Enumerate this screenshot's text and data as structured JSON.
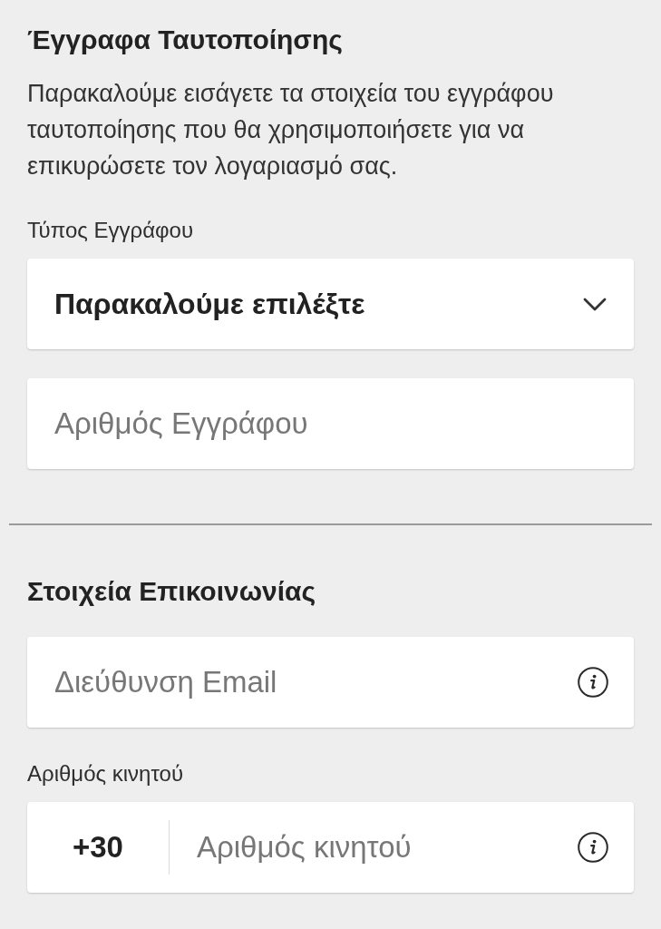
{
  "sections": [
    {
      "title": "Έγγραφα Ταυτοποίησης",
      "description": "Παρακαλούμε εισάγετε τα στοιχεία του εγγράφου ταυτοποίησης που θα χρησιμοποιήσετε για να επικυρώσετε τον λογαριασμό σας.",
      "fields": [
        {
          "kind": "select",
          "label": "Τύπος Εγγράφου",
          "value": "Παρακαλούμε επιλέξτε"
        },
        {
          "kind": "text",
          "placeholder": "Αριθμός Εγγράφου",
          "info": false
        }
      ]
    },
    {
      "title": "Στοιχεία Επικοινωνίας",
      "fields": [
        {
          "kind": "text",
          "placeholder": "Διεύθυνση Email",
          "info": true
        },
        {
          "kind": "phone",
          "label": "Αριθμός κινητού",
          "prefix": "+30",
          "placeholder": "Αριθμός κινητού",
          "info": true
        }
      ]
    }
  ]
}
